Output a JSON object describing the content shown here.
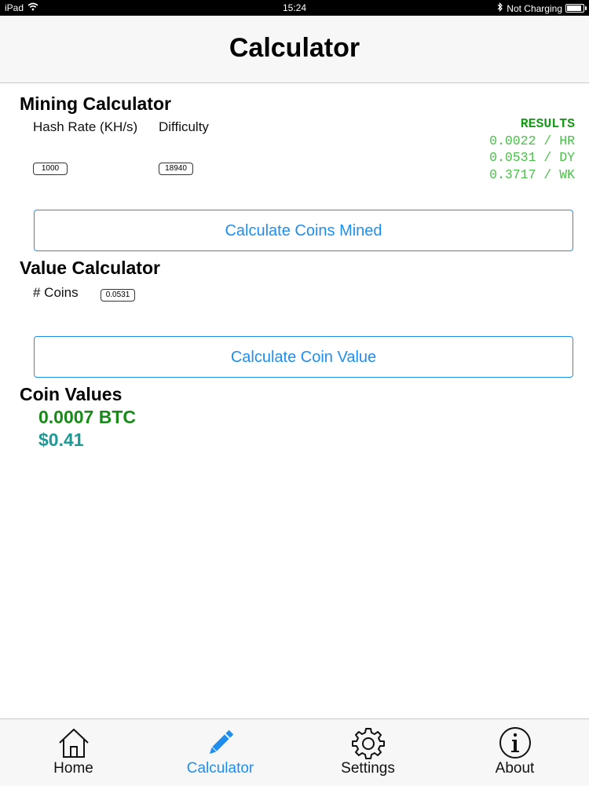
{
  "status_bar": {
    "device": "iPad",
    "time": "15:24",
    "charging": "Not Charging"
  },
  "nav": {
    "title": "Calculator"
  },
  "mining": {
    "title": "Mining Calculator",
    "hash_rate_label": "Hash Rate (KH/s)",
    "difficulty_label": "Difficulty",
    "hash_rate_value": "1000",
    "difficulty_value": "18940",
    "results_header": "RESULTS",
    "results": [
      "0.0022 / HR",
      "0.0531 / DY",
      "0.3717 / WK"
    ],
    "button_label": "Calculate Coins Mined"
  },
  "value": {
    "title": "Value Calculator",
    "coins_label": "# Coins",
    "coins_value": "0.0531",
    "button_label": "Calculate Coin Value"
  },
  "coin_values": {
    "title": "Coin Values",
    "btc": "0.0007 BTC",
    "usd": "$0.41"
  },
  "tabs": [
    {
      "label": "Home",
      "icon": "home-icon"
    },
    {
      "label": "Calculator",
      "icon": "pencil-icon"
    },
    {
      "label": "Settings",
      "icon": "gear-icon"
    },
    {
      "label": "About",
      "icon": "info-icon"
    }
  ],
  "colors": {
    "accent": "#1f8ef1",
    "results_header": "#1a9a1a",
    "results_rows": "#4cbf4c",
    "btc": "#178a17",
    "usd": "#1c9a96"
  }
}
